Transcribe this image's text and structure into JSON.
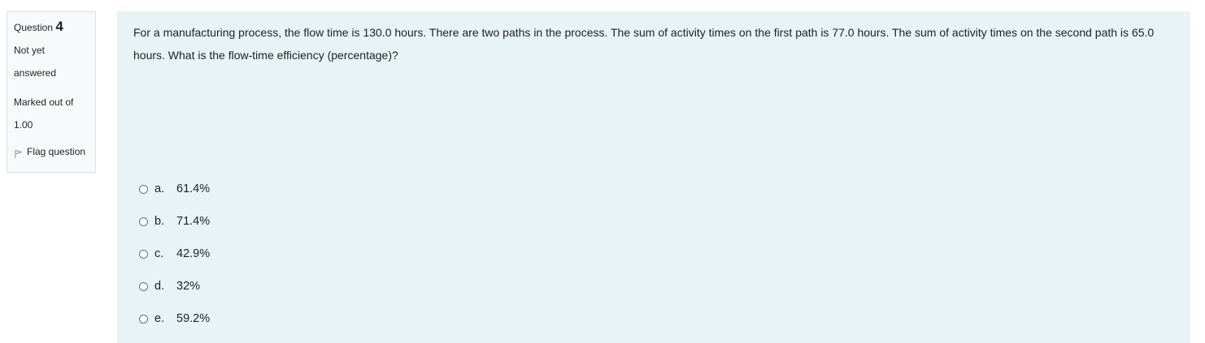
{
  "info": {
    "question_label": "Question",
    "question_number": "4",
    "state_line1": "Not yet",
    "state_line2": "answered",
    "grade_line1": "Marked out of",
    "grade_line2": "1.00",
    "flag_label": "Flag question",
    "flag_icon": "flag-icon"
  },
  "question": {
    "text": "For a  manufacturing process, the flow time is  130.0 hours.  There are two paths in the process. The sum of activity times on the first path is 77.0 hours. The sum of activity times on the second path is 65.0 hours.    What is the flow-time efficiency (percentage)?"
  },
  "answers": [
    {
      "letter": "a.",
      "value": "61.4%"
    },
    {
      "letter": "b.",
      "value": "71.4%"
    },
    {
      "letter": "c.",
      "value": "42.9%"
    },
    {
      "letter": "d.",
      "value": "32%"
    },
    {
      "letter": "e.",
      "value": "59.2%"
    }
  ],
  "colors": {
    "content_bg": "#e7f3f5",
    "info_bg": "#f8f9fa",
    "text": "#1d2125"
  }
}
